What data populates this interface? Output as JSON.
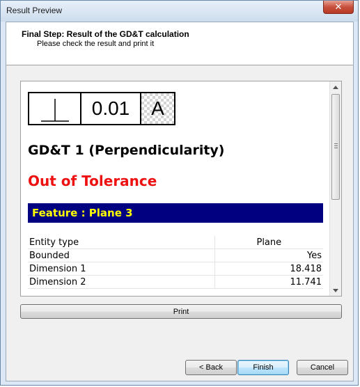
{
  "window": {
    "title": "Result Preview",
    "close_glyph": "✕"
  },
  "header": {
    "title": "Final Step: Result of the GD&T calculation",
    "subtitle": "Please check the result and print it"
  },
  "preview": {
    "fcf": {
      "symbol_icon": "perpendicularity-icon",
      "tolerance": "0.01",
      "datum": "A"
    },
    "gdt_title": "GD&T 1 (Perpendicularity)",
    "status": "Out of Tolerance",
    "status_color": "#ee1111",
    "feature": "Feature : Plane 3",
    "feature_bar_color": "#000080",
    "feature_text_color": "#ffff00",
    "properties": [
      {
        "name": "Entity type",
        "value": "Plane"
      },
      {
        "name": "Bounded",
        "value": "Yes"
      },
      {
        "name": "Dimension 1",
        "value": "18.418"
      },
      {
        "name": "Dimension 2",
        "value": "11.741"
      }
    ]
  },
  "buttons": {
    "print": "Print",
    "back": "< Back",
    "finish": "Finish",
    "cancel": "Cancel"
  }
}
